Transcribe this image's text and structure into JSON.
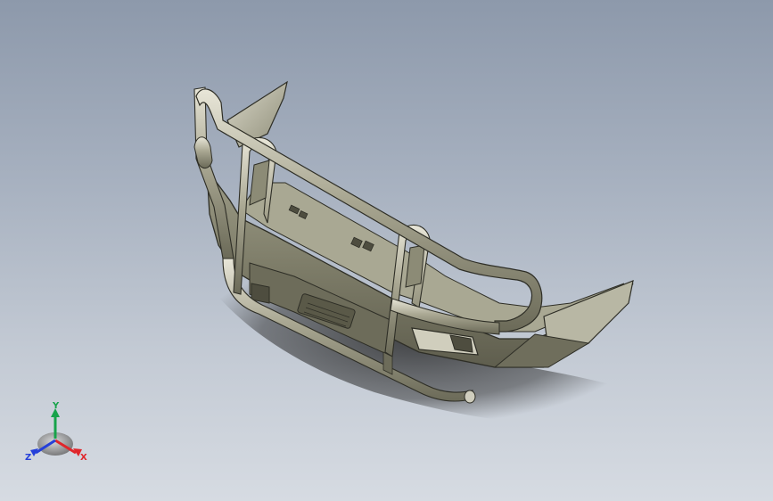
{
  "viewport": {
    "background_top": "#8d99ab",
    "background_bottom": "#d6dbe2",
    "model_color": "#8b8a76",
    "model_edge_color": "#2e2e26"
  },
  "model": {
    "description_icon": "bumper-3d-model"
  },
  "triad": {
    "x_label": "X",
    "y_label": "Y",
    "z_label": "Z",
    "x_color": "#e0262b",
    "y_color": "#17a34a",
    "z_color": "#2540d9"
  }
}
